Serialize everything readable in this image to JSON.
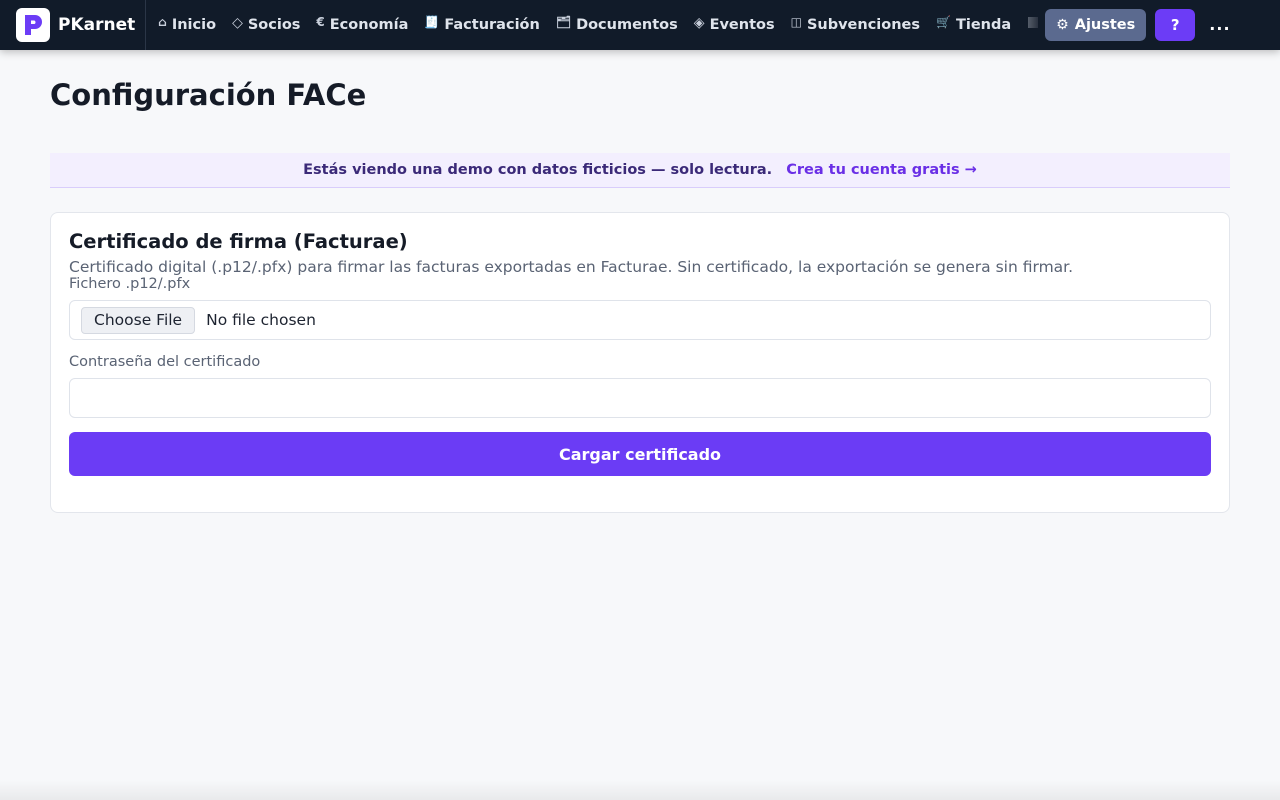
{
  "app": {
    "brand_name": "PKarnet",
    "brand_color": "#6c3cf6"
  },
  "nav": {
    "items": [
      {
        "label": "Inicio",
        "icon": "home-icon",
        "glyph": "⌂"
      },
      {
        "label": "Socios",
        "icon": "diamond-outline-icon",
        "glyph": "◇"
      },
      {
        "label": "Economía",
        "icon": "euro-icon",
        "glyph": "€"
      },
      {
        "label": "Facturación",
        "icon": "receipt-icon",
        "glyph": "🧾"
      },
      {
        "label": "Documentos",
        "icon": "folder-icon",
        "glyph": "🗂"
      },
      {
        "label": "Eventos",
        "icon": "diamond-filled-icon",
        "glyph": "◈"
      },
      {
        "label": "Subvenciones",
        "icon": "columns-icon",
        "glyph": "◫"
      },
      {
        "label": "Tienda",
        "icon": "cart-icon",
        "glyph": "🛒"
      }
    ],
    "settings_label": "Ajustes",
    "settings_icon": "gear-icon",
    "help_label": "?",
    "more_label": "..."
  },
  "page": {
    "title": "Configuración FACe"
  },
  "banner": {
    "text": "Estás viendo una demo con datos ficticios — solo lectura.",
    "link": "Crea tu cuenta gratis →"
  },
  "certificate": {
    "title": "Certificado de firma (Facturae)",
    "description": "Certificado digital (.p12/.pfx) para firmar las facturas exportadas en Facturae. Sin certificado, la exportación se genera sin firmar.",
    "file_label": "Fichero .p12/.pfx",
    "file_button": "Choose File",
    "file_status": "No file chosen",
    "password_label": "Contraseña del certificado",
    "password_value": "",
    "submit_label": "Cargar certificado"
  }
}
